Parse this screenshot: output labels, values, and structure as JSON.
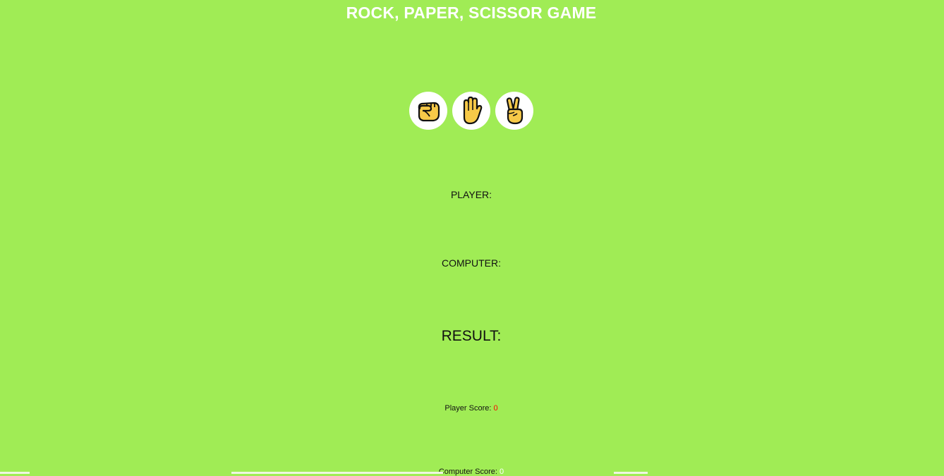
{
  "title": "ROCK, PAPER, SCISSOR GAME",
  "choices": [
    {
      "name": "rock",
      "icon": "fist-icon"
    },
    {
      "name": "paper",
      "icon": "raised-hand-icon"
    },
    {
      "name": "scissor",
      "icon": "victory-hand-icon"
    }
  ],
  "player": {
    "label": "PLAYER:",
    "choice": ""
  },
  "computer": {
    "label": "COMPUTER:",
    "choice": ""
  },
  "result": {
    "label": "RESULT:",
    "value": ""
  },
  "scores": {
    "player_label": "Player Score:",
    "player_value": "0",
    "computer_label": "Computer Score:",
    "computer_value": "0"
  },
  "colors": {
    "background": "#a0ec55",
    "title": "#ffffff",
    "player_score": "#ff0000",
    "computer_score": "#ffffff",
    "emoji_fill": "#f7c948"
  }
}
